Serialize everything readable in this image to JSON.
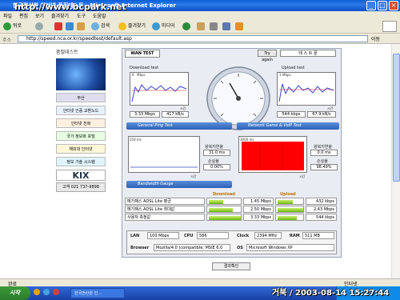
{
  "window": {
    "title": "한국전산원 인터넷 품질테스트 - Microsoft Internet Explorer",
    "watermark": "http://www.bcpark.net"
  },
  "menu": {
    "items": [
      "파일",
      "편집",
      "보기",
      "즐겨찾기",
      "도구",
      "도움말"
    ]
  },
  "toolbar": {
    "back": "뒤로",
    "search": "검색",
    "favorites": "즐겨찾기",
    "media": "미디어"
  },
  "address": {
    "label": "주소",
    "url": "http://speed.nca.or.kr/speedtest/default.asp",
    "go": "이동"
  },
  "sidebar": {
    "title": "품질테스트",
    "banners": [
      "부산",
      "인터넷 인증 교환노드",
      "인터넷 전화",
      "국가 정보화 포털",
      "해외대 인터넷",
      "정보 기술 시스템"
    ],
    "kix": "KIX",
    "phone": "고객 021 737-9898"
  },
  "speedtest": {
    "tab": "WAN TEST",
    "try_again": "Try again",
    "test_end": "테 스 트 끝",
    "download": {
      "title": "Download test",
      "axis_y": "Mbps",
      "axis_x": "시간",
      "mbps": "3.33 Mbps",
      "kbs": "417 kB/s",
      "y_top": "6"
    },
    "upload": {
      "title": "Upload test",
      "axis_y": "Mbps",
      "axis_x": "시간",
      "kbps": "544 kbps",
      "kbs": "67.9 kB/s",
      "y_top": "1"
    },
    "ping": {
      "title": "General Ping Test",
      "y_top": "259 ms",
      "axis_x": "시간",
      "delay_label": "왕복지연율",
      "delay": "31.0 ms",
      "loss_label": "손실율",
      "loss": "0.00%"
    },
    "game": {
      "title": "Network Game & VoIP Test",
      "y_top": "3000 ms",
      "axis_x": "시간",
      "delay_label": "왕복지연율",
      "delay": "0.0 ms",
      "loss_label": "손실율",
      "loss": "98.49%"
    },
    "bandwidth": {
      "title": "Bandwidth Gauge",
      "col_download": "Download",
      "col_upload": "Upload",
      "rows": [
        {
          "label": "메가패스 ADSL Lite 평균",
          "download": "1.45 Mbps",
          "dl_fill": 0.44,
          "upload": "432 kbps",
          "ul_fill": 0.6
        },
        {
          "label": "메가패스 ADSL Lite 최대값",
          "download": "2.50 Mbps",
          "dl_fill": 0.75,
          "upload": "2.43 Mbps",
          "ul_fill": 1.0
        },
        {
          "label": "사용자 측정값",
          "download": "3.33 Mbps",
          "dl_fill": 1.0,
          "upload": "544 kbps",
          "ul_fill": 0.75
        }
      ]
    },
    "system": {
      "lan_label": "LAN",
      "lan": "100 Mbps",
      "cpu_label": "CPU",
      "cpu": "586",
      "clock_label": "Clock",
      "clock": "2394 MHz",
      "ram_label": "RAM",
      "ram": "511 MB",
      "browser_label": "Browser",
      "browser": "Mozilla/4.0 (compatible; MSIE 6.0",
      "os_label": "OS",
      "os": "Microsoft Windows XP"
    },
    "result_button": "결과확인"
  },
  "statusbar": {
    "status": "완료",
    "zone": "인터넷"
  },
  "taskbar": {
    "start": "시작",
    "task": "한국전산원 인...",
    "timestamp": "거북 / 2003-08-14 15:27:44"
  },
  "colors": {
    "accent": "#2c61b8",
    "game_graph": "#ff0000",
    "gauge_fill": "#8ad02a"
  }
}
